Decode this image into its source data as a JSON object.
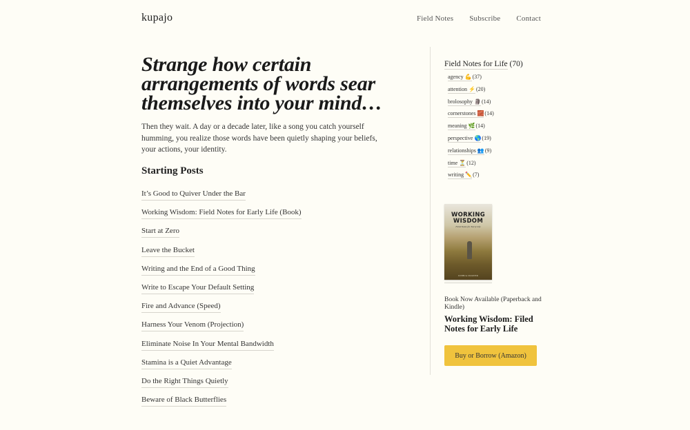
{
  "site": {
    "title": "kupajo"
  },
  "nav": {
    "items": [
      "Field Notes",
      "Subscribe",
      "Contact"
    ]
  },
  "main": {
    "headline": "Strange how certain arrangements of words sear themselves into your mind…",
    "intro": "Then they wait. A day or a decade later, like a song you catch yourself humming, you realize those words have been quietly shaping your beliefs, your actions, your identity.",
    "section_heading": "Starting Posts",
    "posts": [
      "It’s Good to Quiver Under the Bar",
      "Working Wisdom: Field Notes for Early Life (Book)",
      "Start at Zero",
      "Leave the Bucket",
      "Writing and the End of a Good Thing",
      "Write to Escape Your Default Setting",
      "Fire and Advance (Speed)",
      "Harness Your Venom (Projection)",
      "Eliminate Noise In Your Mental Bandwidth",
      "Stamina is a Quiet Advantage",
      "Do the Right Things Quietly",
      "Beware of Black Butterflies"
    ]
  },
  "sidebar": {
    "heading": "Field Notes for Life",
    "heading_count": "(70)",
    "categories": [
      {
        "name": "agency",
        "emoji": "💪",
        "count": "(37)"
      },
      {
        "name": "attention",
        "emoji": "⚡",
        "count": "(20)"
      },
      {
        "name": "brolosophy",
        "emoji": "🗿",
        "count": "(14)"
      },
      {
        "name": "cornerstones",
        "emoji": "🧱",
        "count": "(14)"
      },
      {
        "name": "meaning",
        "emoji": "🌿",
        "count": "(14)"
      },
      {
        "name": "perspective",
        "emoji": "🌎",
        "count": "(19)"
      },
      {
        "name": "relationships",
        "emoji": "👥",
        "count": "(9)"
      },
      {
        "name": "time",
        "emoji": "⏳",
        "count": "(12)"
      },
      {
        "name": "writing",
        "emoji": "✏️",
        "count": "(7)"
      }
    ],
    "book": {
      "cover_title_line1": "WORKING",
      "cover_title_line2": "WISDOM",
      "cover_subtitle": "Field Notes for Early Life",
      "cover_author": "JOSHUA CROZIER",
      "availability": "Book Now Available (Paperback and Kindle)",
      "name": "Working Wisdom: Filed Notes for Early Life",
      "button_label": "Buy or Borrow (Amazon)",
      "button_color": "#f0c33d"
    }
  }
}
